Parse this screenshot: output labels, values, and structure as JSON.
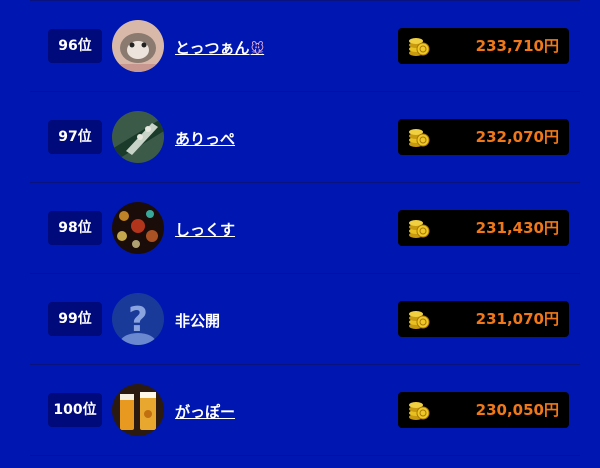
{
  "ranking": [
    {
      "rank": "96位",
      "name": "とっつぁん",
      "name_suffix": "🐭",
      "amount": "233,710円",
      "linked": true,
      "avatar": "photo-hamster"
    },
    {
      "rank": "97位",
      "name": "ありっぺ",
      "name_suffix": "",
      "amount": "232,070円",
      "linked": true,
      "avatar": "photo-green"
    },
    {
      "rank": "98位",
      "name": "しっくす",
      "name_suffix": "",
      "amount": "231,430円",
      "linked": true,
      "avatar": "photo-bokeh"
    },
    {
      "rank": "99位",
      "name": "非公開",
      "name_suffix": "",
      "amount": "231,070円",
      "linked": false,
      "avatar": "question-icon"
    },
    {
      "rank": "100位",
      "name": "がっぽー",
      "name_suffix": "",
      "amount": "230,050円",
      "linked": true,
      "avatar": "photo-beer"
    }
  ],
  "colors": {
    "background": "#0016b0",
    "rank_badge": "#000a7a",
    "amount_text": "#f07818",
    "amount_box": "#000000"
  }
}
